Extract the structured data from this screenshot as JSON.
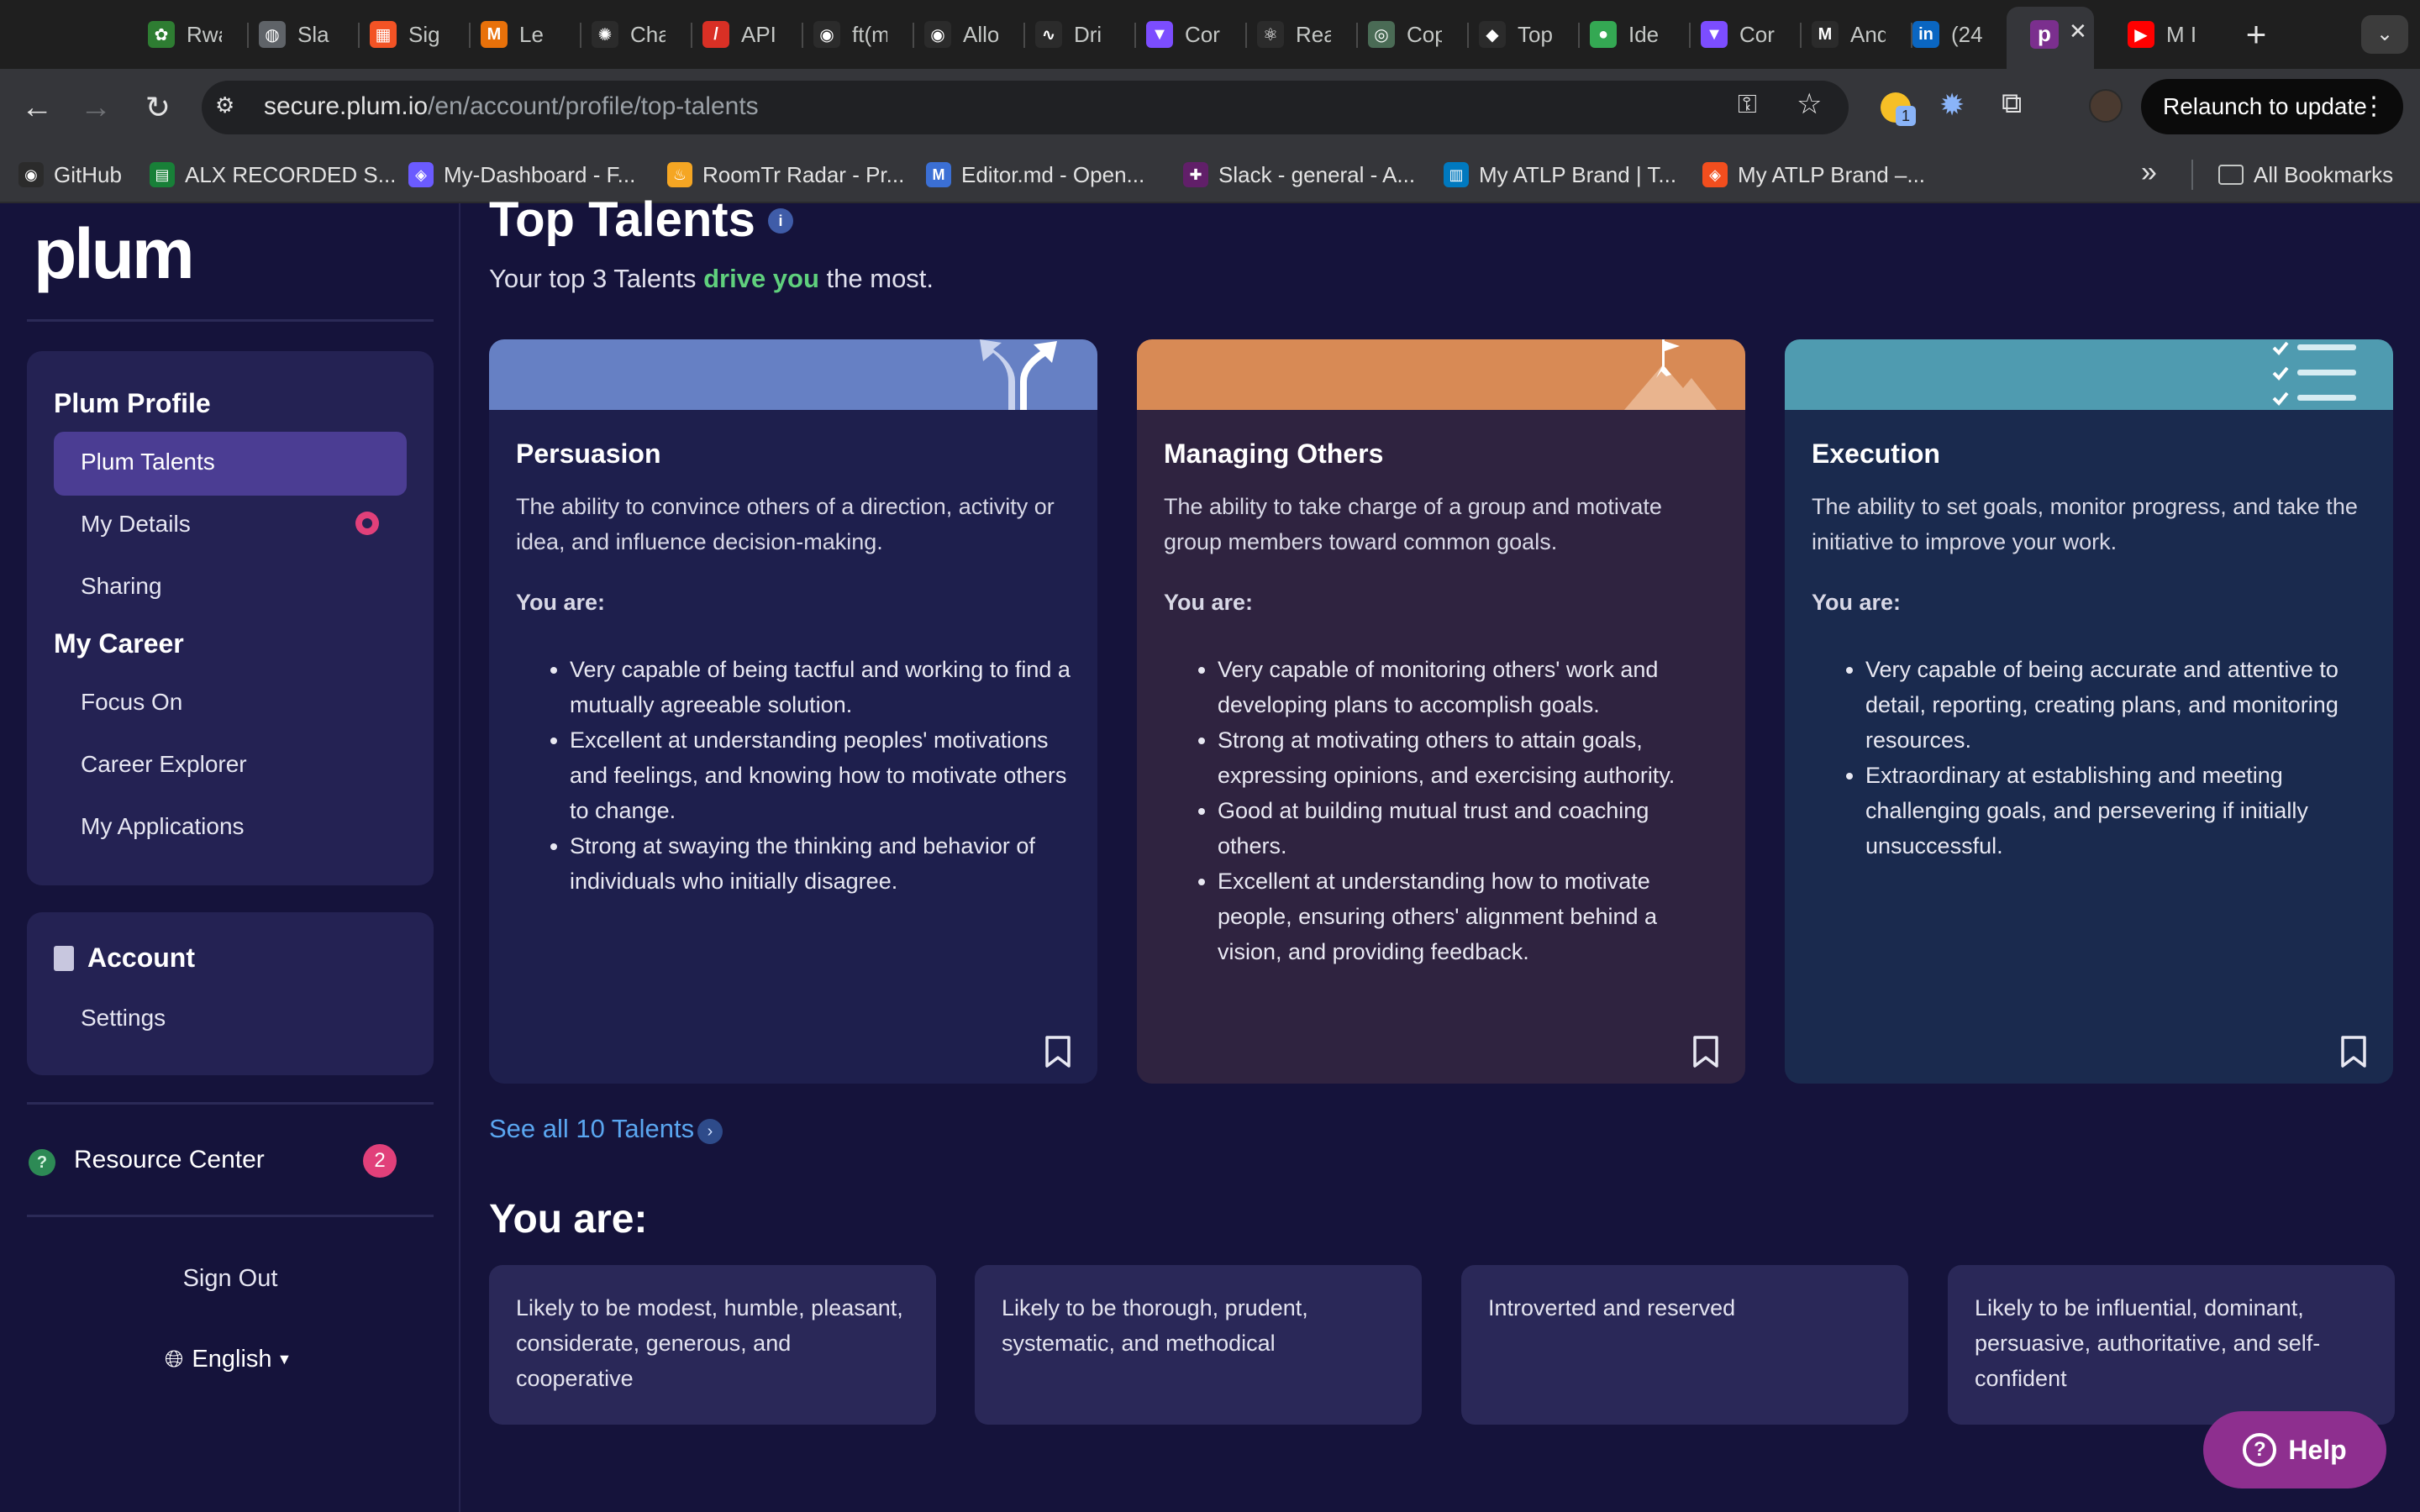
{
  "browser": {
    "tabs": [
      {
        "title": "Rwa",
        "icon": "leaf-icon",
        "color": "#2e7d32",
        "glyph": "✿"
      },
      {
        "title": "Sla",
        "icon": "globe-icon",
        "color": "#5f6368",
        "glyph": "◍"
      },
      {
        "title": "Sig",
        "icon": "microsoft-icon",
        "color": "#f35325",
        "glyph": "▦"
      },
      {
        "title": "Le",
        "icon": "m-logo-icon",
        "color": "#e8710a",
        "glyph": "M"
      },
      {
        "title": "Cha",
        "icon": "chatgpt-icon",
        "color": "#2b2b2b",
        "glyph": "✺"
      },
      {
        "title": "API",
        "icon": "api-icon",
        "color": "#d93025",
        "glyph": "/"
      },
      {
        "title": "ft(m",
        "icon": "github-icon",
        "color": "#2b2b2b",
        "glyph": "◉"
      },
      {
        "title": "Allo",
        "icon": "github-icon",
        "color": "#2b2b2b",
        "glyph": "◉"
      },
      {
        "title": "Dri",
        "icon": "chart-icon",
        "color": "#2b2b2b",
        "glyph": "∿"
      },
      {
        "title": "Cor",
        "icon": "vite-icon",
        "color": "#7c4dff",
        "glyph": "▼"
      },
      {
        "title": "Rea",
        "icon": "react-icon",
        "color": "#2b2b2b",
        "glyph": "⚛"
      },
      {
        "title": "Cop",
        "icon": "openai-icon",
        "color": "#4a6b55",
        "glyph": "◎"
      },
      {
        "title": "Top",
        "icon": "shield-icon",
        "color": "#2b2b2b",
        "glyph": "◆"
      },
      {
        "title": "Ide",
        "icon": "map-pin-icon",
        "color": "#34a853",
        "glyph": "●"
      },
      {
        "title": "Cor",
        "icon": "vite-icon",
        "color": "#7c4dff",
        "glyph": "▼"
      },
      {
        "title": "And",
        "icon": "gmail-icon",
        "color": "#2b2b2b",
        "glyph": "M"
      },
      {
        "title": "(24",
        "icon": "linkedin-icon",
        "color": "#0a66c2",
        "glyph": "in"
      },
      {
        "title": "M I",
        "icon": "youtube-icon",
        "color": "#ff0000",
        "glyph": "▶"
      }
    ],
    "active_tab": {
      "icon": "plum-icon",
      "glyph": "p",
      "color": "#7b2f8e",
      "close": "✕"
    },
    "new_tab": "+",
    "tab_menu": "⌄",
    "url_host": "secure.plum.io",
    "url_path": "/en/account/profile/top-talents",
    "relaunch_label": "Relaunch to update",
    "extension_badge": "1",
    "bookmarks": [
      {
        "label": "GitHub",
        "icon": "github-icon",
        "color": "#2b2b2b",
        "glyph": "◉"
      },
      {
        "label": "ALX RECORDED S...",
        "icon": "sheets-icon",
        "color": "#188038",
        "glyph": "▤"
      },
      {
        "label": "My-Dashboard - F...",
        "icon": "figma-icon",
        "color": "#6b5bff",
        "glyph": "◈"
      },
      {
        "label": "RoomTr Radar - Pr...",
        "icon": "flame-icon",
        "color": "#f5a623",
        "glyph": "♨"
      },
      {
        "label": "Editor.md - Open...",
        "icon": "markdown-icon",
        "color": "#3b6fd4",
        "glyph": "M"
      },
      {
        "label": "Slack - general - A...",
        "icon": "slack-icon",
        "color": "#611f69",
        "glyph": "✚"
      },
      {
        "label": "My ATLP Brand | T...",
        "icon": "trello-icon",
        "color": "#0079bf",
        "glyph": "▥"
      },
      {
        "label": "My ATLP Brand –...",
        "icon": "figma-icon",
        "color": "#f24e1e",
        "glyph": "◈"
      }
    ],
    "bookmarks_more": "»",
    "all_bookmarks": "All Bookmarks"
  },
  "sidebar": {
    "logo": "plum",
    "profile_heading": "Plum Profile",
    "profile_items": [
      "Plum Talents",
      "My Details",
      "Sharing"
    ],
    "career_heading": "My Career",
    "career_items": [
      "Focus On",
      "Career Explorer",
      "My Applications"
    ],
    "account_heading": "Account",
    "account_items": [
      "Settings"
    ],
    "resource_center": "Resource Center",
    "resource_badge": "2",
    "sign_out": "Sign Out",
    "language": "English"
  },
  "main": {
    "title": "Top Talents",
    "subtitle_pre": "Your top 3 Talents ",
    "subtitle_highlight": "drive you",
    "subtitle_post": " the most.",
    "cards": [
      {
        "title": "Persuasion",
        "band_color": "#6680c4",
        "bg_color": "#1e1f4d",
        "icon": "diverging-arrows-icon",
        "description": "The ability to convince others of a direction, activity or idea, and influence decision-making.",
        "you_are": "You are:",
        "points": [
          "Very capable of being tactful and working to find a mutually agreeable solution.",
          "Excellent at understanding peoples' motivations and feelings, and knowing how to motivate others to change.",
          "Strong at swaying the thinking and behavior of individuals who initially disagree."
        ]
      },
      {
        "title": "Managing Others",
        "band_color": "#d88a55",
        "bg_color": "#2f2340",
        "icon": "mountain-flag-icon",
        "description": "The ability to take charge of a group and motivate group members toward common goals.",
        "you_are": "You are:",
        "points": [
          "Very capable of monitoring others' work and developing plans to accomplish goals.",
          "Strong at motivating others to attain goals, expressing opinions, and exercising authority.",
          "Good at building mutual trust and coaching others.",
          "Excellent at understanding how to motivate people, ensuring others' alignment behind a vision, and providing feedback."
        ]
      },
      {
        "title": "Execution",
        "band_color": "#4f9bb0",
        "bg_color": "#1a2a4e",
        "icon": "checklist-icon",
        "description": "The ability to set goals, monitor progress, and take the initiative to improve your work.",
        "you_are": "You are:",
        "points": [
          "Very capable of being accurate and attentive to detail, reporting, creating plans, and monitoring resources.",
          "Extraordinary at establishing and meeting challenging goals, and persevering if initially unsuccessful."
        ]
      }
    ],
    "see_all": "See all 10 Talents",
    "you_are_heading": "You are:",
    "traits": [
      "Likely to be modest, humble, pleasant, considerate, generous, and cooperative",
      "Likely to be thorough, prudent, systematic, and methodical",
      "Introverted and reserved",
      "Likely to be influential, dominant, persuasive, authoritative, and self-confident"
    ],
    "help_label": "Help"
  }
}
